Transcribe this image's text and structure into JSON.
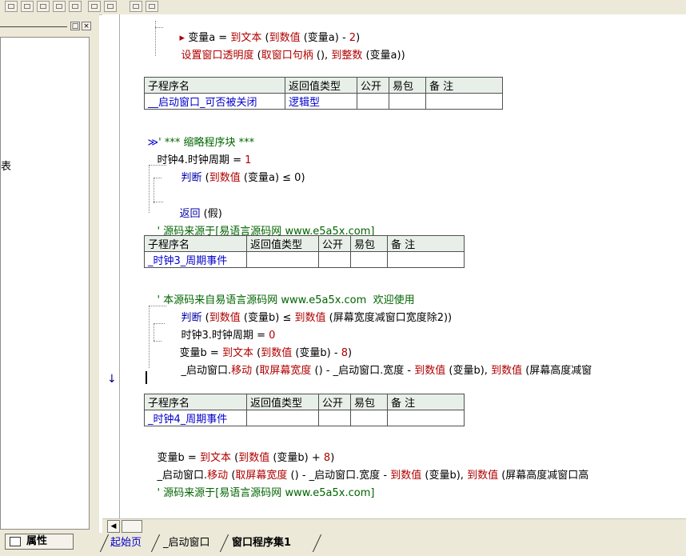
{
  "toolbar": {
    "buttons": [
      "layout-icon",
      "layout-icon",
      "layout-icon",
      "layout-icon",
      "layout-icon",
      "layout-icon",
      "layout-icon",
      "layout-icon",
      "layout-icon"
    ]
  },
  "left_panel": {
    "close_glyph": "×",
    "restore_glyph": "□",
    "partial_char": "表",
    "properties_tab": "属性"
  },
  "code": {
    "line1": {
      "a": "变量a",
      "eq": " = ",
      "fn": "到文本",
      "p": " (",
      "fn2": "到数值",
      "p2": " (变量a) - ",
      "n": "2",
      "e": ")"
    },
    "line2": {
      "fn": "设置窗口透明度",
      "p": " (",
      "fn2": "取窗口句柄",
      "p2": " (), ",
      "fn3": "到整数",
      "p3": " (变量a))"
    },
    "table1": {
      "headers": [
        "子程序名",
        "返回值类型",
        "公开",
        "易包",
        "备 注"
      ],
      "row": [
        "__启动窗口_可否被关闭",
        "逻辑型",
        "",
        "",
        ""
      ]
    },
    "line3": {
      "mark": "≫",
      "text": "' *** 缩略程序块 ***"
    },
    "line4": {
      "a": "时钟4.时钟周期",
      "eq": " = ",
      "n": "1"
    },
    "line5": {
      "kw": "判断",
      "p": " (",
      "fn": "到数值",
      "rest": " (变量a) ≤ 0)"
    },
    "line6": {
      "kw": "返回",
      "rest": " (假)"
    },
    "line7": {
      "text": "' 源码来源于[易语言源码网 www.e5a5x.com]"
    },
    "table2": {
      "headers": [
        "子程序名",
        "返回值类型",
        "公开",
        "易包",
        "备 注"
      ],
      "row": [
        "_时钟3_周期事件",
        "",
        "",
        "",
        ""
      ]
    },
    "line8": {
      "text": "' 本源码来自易语言源码网 www.e5a5x.com  欢迎使用"
    },
    "line9": {
      "kw": "判断",
      "p": " (",
      "fn": "到数值",
      "mid": " (变量b) ≤ ",
      "fn2": "到数值",
      "rest": " (屏幕宽度减窗口宽度除2))"
    },
    "line10": {
      "a": "时钟3.时钟周期",
      "eq": " = ",
      "n": "0"
    },
    "line11": {
      "a": "变量b",
      "eq": " = ",
      "fn": "到文本",
      "p": " (",
      "fn2": "到数值",
      "p2": " (变量b) - ",
      "n": "8",
      "e": ")"
    },
    "line12": {
      "a": "_启动窗口.",
      "fn": "移动",
      "p": " (",
      "fn2": "取屏幕宽度",
      "p2": " () - _启动窗口.宽度 - ",
      "fn3": "到数值",
      "p3": " (变量b), ",
      "fn4": "到数值",
      "p4": " (屏幕高度减窗"
    },
    "table3": {
      "headers": [
        "子程序名",
        "返回值类型",
        "公开",
        "易包",
        "备 注"
      ],
      "row": [
        "_时钟4_周期事件",
        "",
        "",
        "",
        ""
      ]
    },
    "line13": {
      "a": "变量b",
      "eq": " = ",
      "fn": "到文本",
      "p": " (",
      "fn2": "到数值",
      "p2": " (变量b) + ",
      "n": "8",
      "e": ")"
    },
    "line14": {
      "a": "_启动窗口.",
      "fn": "移动",
      "p": " (",
      "fn2": "取屏幕宽度",
      "p2": " () - _启动窗口.宽度 - ",
      "fn3": "到数值",
      "p3": " (变量b), ",
      "fn4": "到数值",
      "p4": " (屏幕高度减窗口高"
    },
    "line15": {
      "text": "' 源码来源于[易语言源码网 www.e5a5x.com]"
    }
  },
  "gutter": {
    "arrow": "↓"
  },
  "tabs": [
    "起始页",
    "_启动窗口",
    "窗口程序集1"
  ]
}
